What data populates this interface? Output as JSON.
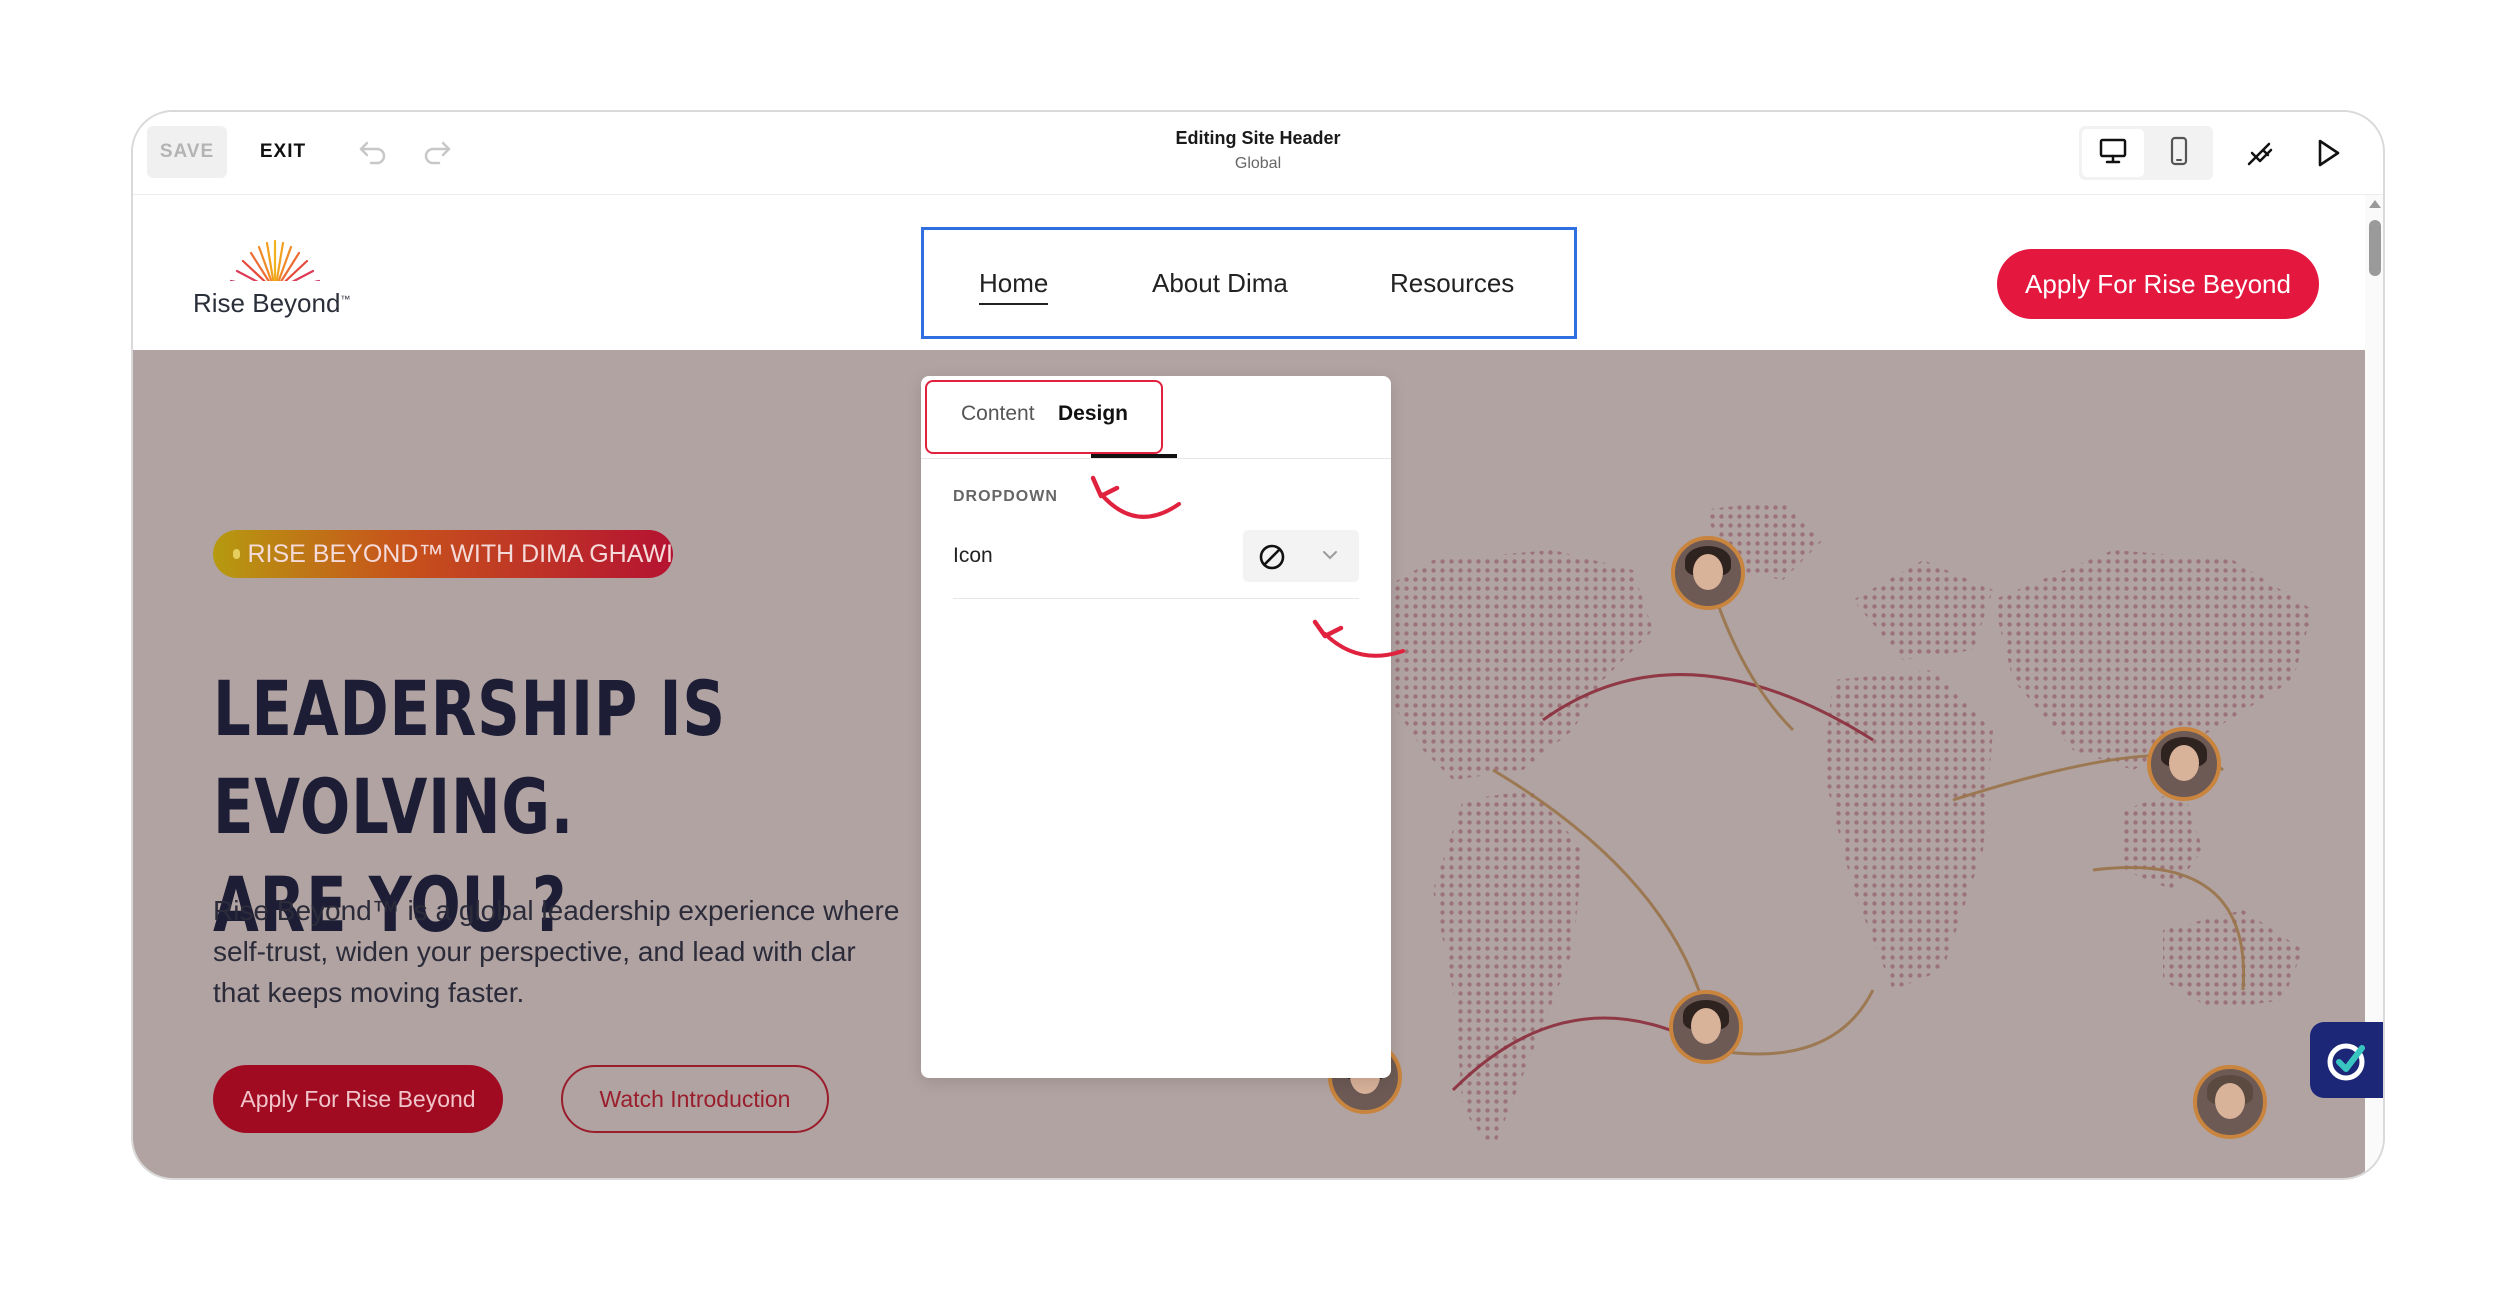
{
  "toolbar": {
    "save_label": "SAVE",
    "exit_label": "EXIT",
    "editing_title": "Editing Site Header",
    "editing_scope": "Global",
    "icons": [
      "undo-icon",
      "redo-icon",
      "desktop-icon",
      "mobile-icon",
      "paintbrush-icon",
      "play-icon"
    ]
  },
  "site": {
    "logo_text": "Rise Beyond",
    "logo_tm": "™",
    "nav": [
      {
        "label": "Home"
      },
      {
        "label": "About Dima"
      },
      {
        "label": "Resources"
      }
    ],
    "cta_label": "Apply For Rise Beyond"
  },
  "hero": {
    "pill_text": "RISE BEYOND™ WITH DIMA GHAWI",
    "headline_line1": "LEADERSHIP IS EVOLVING.",
    "headline_line2": "ARE YOU ?",
    "para_line1": "Rise Beyond™ is a global leadership experience where",
    "para_line2": "self-trust, widen your  perspective, and lead with clar",
    "para_line3": "that keeps moving faster.",
    "primary_button": "Apply For Rise Beyond",
    "secondary_button": "Watch Introduction"
  },
  "popup": {
    "tab_content": "Content",
    "tab_design": "Design",
    "section_label": "DROPDOWN",
    "icon_row_label": "Icon",
    "icon_value_icon": "none-icon"
  },
  "colors": {
    "accent_red": "#e4173e",
    "selection_blue": "#2f6fe0",
    "annotation_red": "#e0223f",
    "headline_navy": "#1d1d35"
  }
}
